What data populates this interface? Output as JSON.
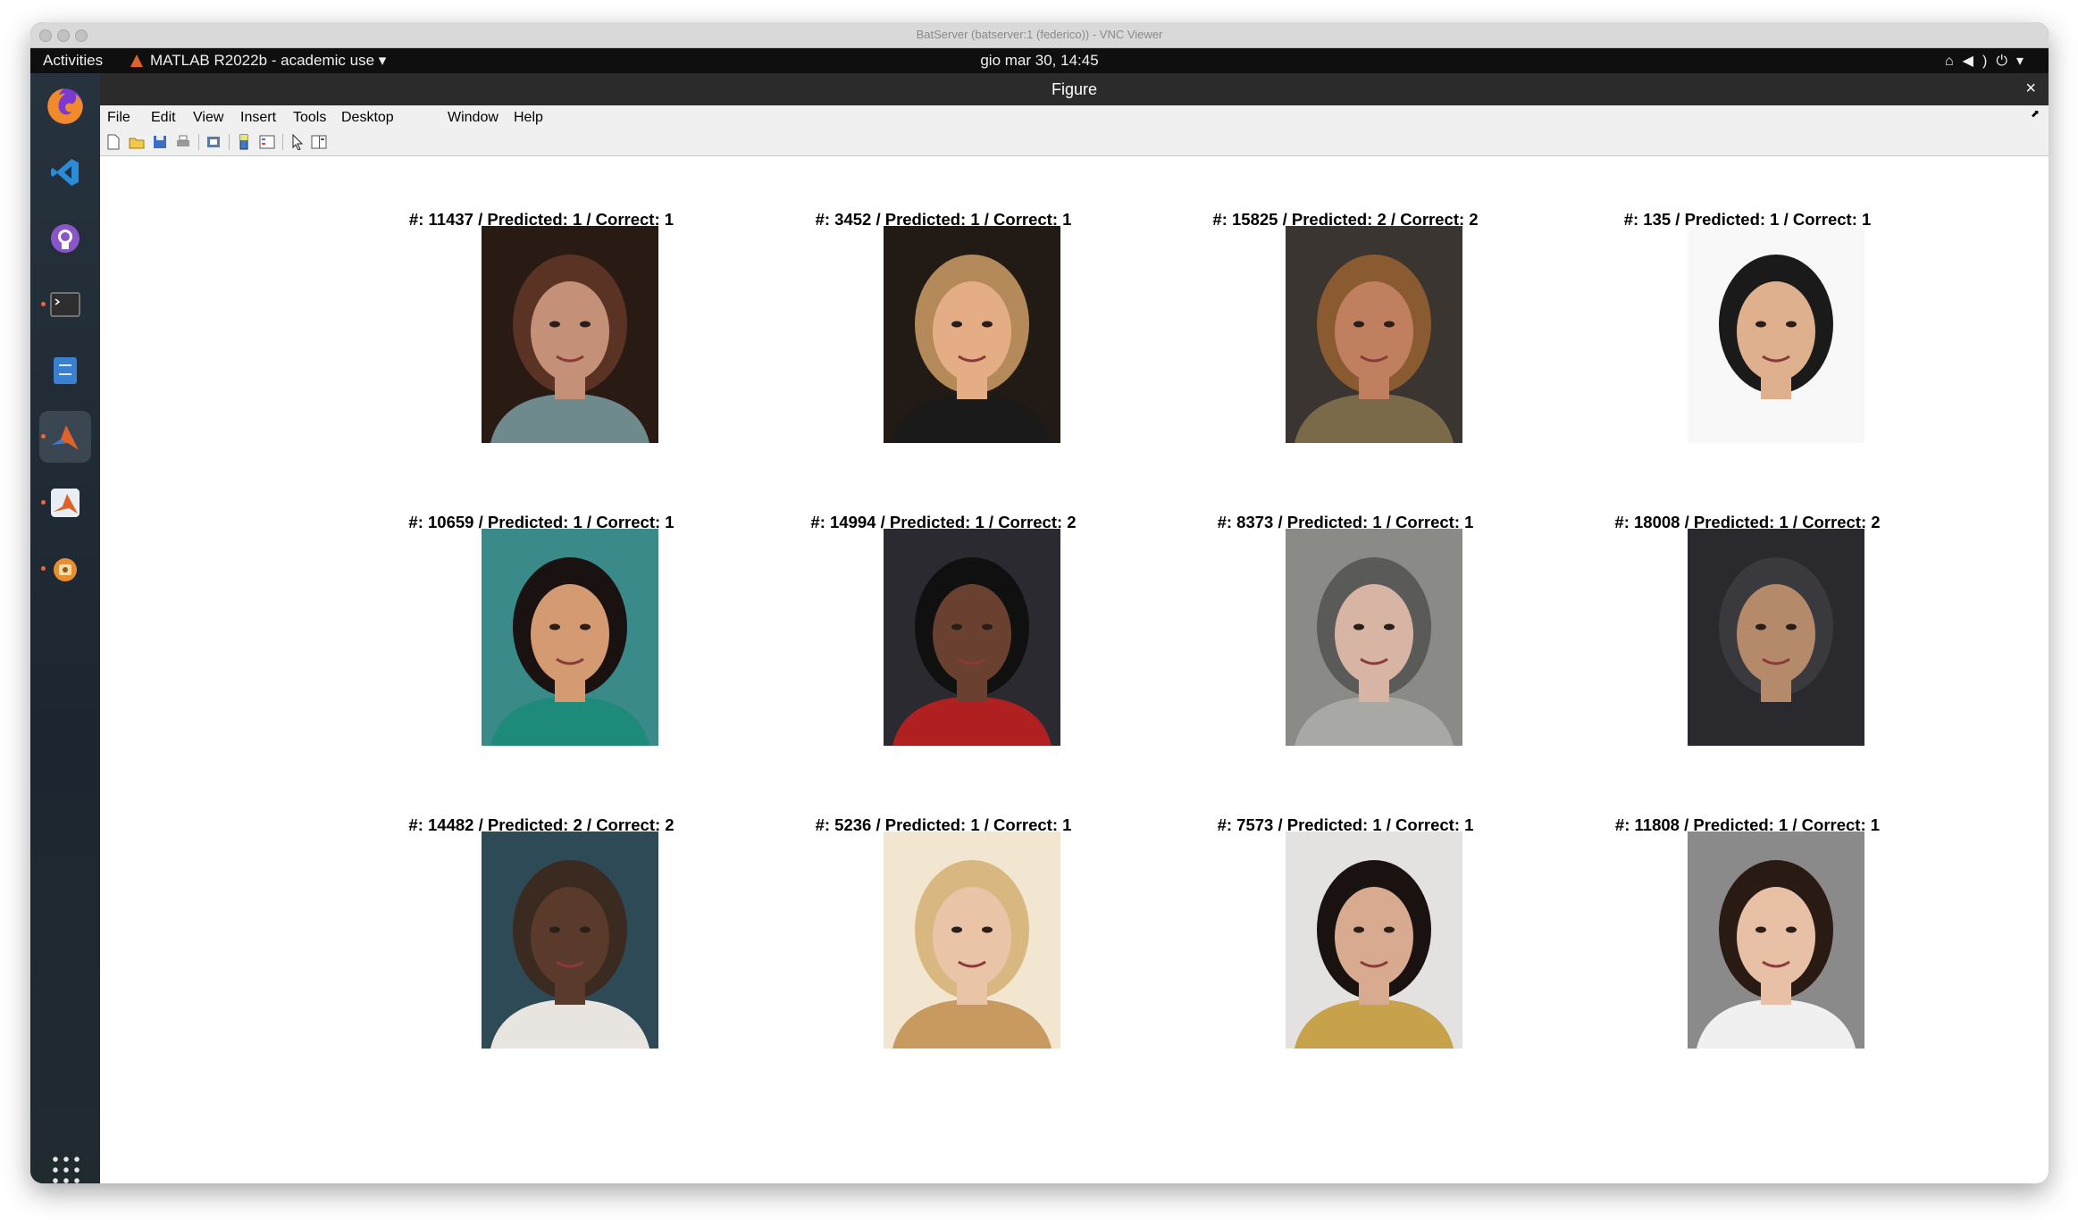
{
  "vnc": {
    "title": "BatServer (batserver:1 (federico)) - VNC Viewer"
  },
  "topbar": {
    "activities": "Activities",
    "app_menu": "MATLAB R2022b - academic use ▾",
    "clock": "gio mar 30, 14:45",
    "tray_icons": [
      "network-icon",
      "volume-icon",
      "power-icon",
      "chevron-down-icon"
    ]
  },
  "dock": {
    "apps": [
      "firefox",
      "vscode",
      "github-desktop",
      "terminal",
      "files",
      "matlab",
      "matlab-installer",
      "software-updater"
    ],
    "running": [
      "terminal",
      "matlab",
      "matlab-installer",
      "software-updater"
    ],
    "active": "matlab",
    "colors": {
      "firefox": "#f0752b",
      "vscode": "#2a8bd8",
      "github": "#8a55c9",
      "terminal": "#2e2e2e",
      "files": "#3b7fd0",
      "matlab": "#e0622b",
      "updater": "#e58f2e"
    }
  },
  "figure": {
    "title": "Figure",
    "close": "×",
    "menus": [
      "File",
      "Edit",
      "View",
      "Insert",
      "Tools",
      "Desktop",
      "Window",
      "Help"
    ],
    "toolbar": [
      "new-figure-icon",
      "open-icon",
      "save-icon",
      "print-icon",
      "print-preview-icon",
      "insert-colorbar-icon",
      "insert-legend-icon",
      "pointer-icon",
      "property-editor-icon"
    ],
    "panels": [
      {
        "label": "#: 11437 / Predicted: 1 / Correct: 1",
        "bg": "#2a1a14",
        "skin": "#c49077",
        "hair": "#5a3324",
        "cloth": "#6e8a8c"
      },
      {
        "label": "#: 3452 / Predicted: 1 / Correct: 1",
        "bg": "#221a14",
        "skin": "#e4ad86",
        "hair": "#b58a5a",
        "cloth": "#1a1a1a"
      },
      {
        "label": "#: 15825 / Predicted: 2 / Correct: 2",
        "bg": "#3a3530",
        "skin": "#c08060",
        "hair": "#8a5a30",
        "cloth": "#7a6a4a"
      },
      {
        "label": "#: 135 / Predicted: 1 / Correct: 1",
        "bg": "#f8f8f8",
        "skin": "#deb08e",
        "hair": "#1a1a1a",
        "cloth": "#f8f8f8"
      },
      {
        "label": "#: 10659 / Predicted: 1 / Correct: 1",
        "bg": "#3a8a8a",
        "skin": "#d49a72",
        "hair": "#1a1210",
        "cloth": "#1e8a7a"
      },
      {
        "label": "#: 14994 / Predicted: 1 / Correct: 2",
        "bg": "#2a2a30",
        "skin": "#6a4030",
        "hair": "#101010",
        "cloth": "#b02020"
      },
      {
        "label": "#: 8373 / Predicted: 1 / Correct: 1",
        "bg": "#8a8a86",
        "skin": "#d8b4a4",
        "hair": "#5a5a58",
        "cloth": "#a8a8a4"
      },
      {
        "label": "#: 18008 / Predicted: 1 / Correct: 2",
        "bg": "#2a2a2e",
        "skin": "#b48a6a",
        "hair": "#3a3a3e",
        "cloth": "#2a2a2e"
      },
      {
        "label": "#: 14482 / Predicted: 2 / Correct: 2",
        "bg": "#2e4a56",
        "skin": "#5a3a2a",
        "hair": "#3a2a20",
        "cloth": "#e8e4e0"
      },
      {
        "label": "#: 5236 / Predicted: 1 / Correct: 1",
        "bg": "#f2e6d0",
        "skin": "#eac4a6",
        "hair": "#d8b880",
        "cloth": "#c89a60"
      },
      {
        "label": "#: 7573 / Predicted: 1 / Correct: 1",
        "bg": "#e4e2e0",
        "skin": "#d8aa90",
        "hair": "#1a1210",
        "cloth": "#c8a24a"
      },
      {
        "label": "#: 11808 / Predicted: 1 / Correct: 1",
        "bg": "#8a8a8a",
        "skin": "#e8c0a6",
        "hair": "#2a1a14",
        "cloth": "#f0f0f0"
      }
    ]
  }
}
